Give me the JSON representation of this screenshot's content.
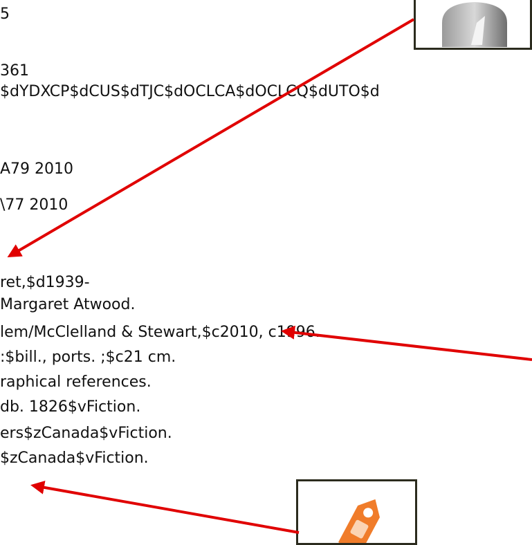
{
  "record_lines": [
    "5",
    "361",
    "$dYDXCP$dCUS$dTJC$dOCLCA$dOCLCQ$dUTO$d",
    "A79 2010",
    "\\77 2010",
    "ret,$d1939-",
    "Margaret Atwood.",
    "lem/McClelland & Stewart,$c2010, c1996.",
    ":$bill., ports. ;$c21 cm.",
    "raphical references.",
    "db. 1826$vFiction.",
    "ers$zCanada$vFiction.",
    "$zCanada$vFiction."
  ],
  "icons": {
    "top_right": "person-silhouette-icon",
    "bottom": "orange-tag-icon"
  },
  "colors": {
    "arrow": "#e00000",
    "box_border": "#2b2b1e",
    "tag_orange": "#f07c2a"
  }
}
